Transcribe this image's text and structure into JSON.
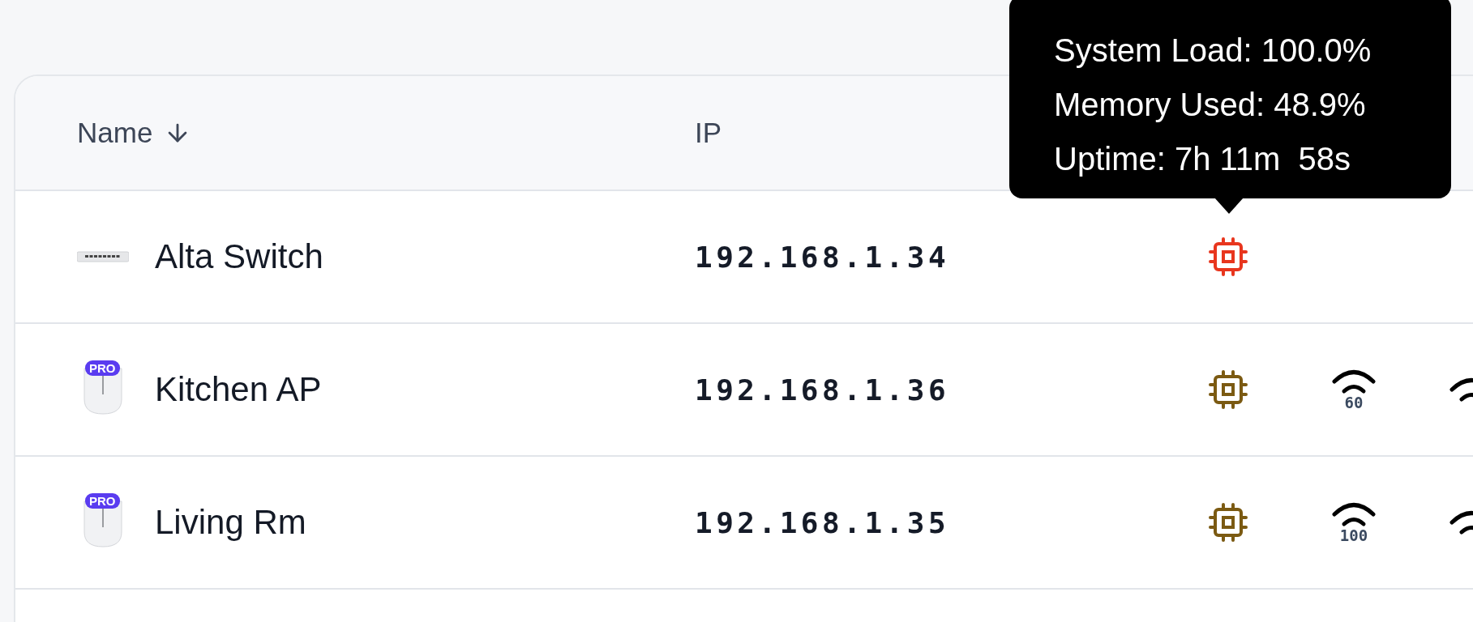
{
  "table": {
    "columns": [
      {
        "label": "Name",
        "sort_descending": true
      },
      {
        "label": "IP"
      }
    ],
    "rows": [
      {
        "kind": "switch",
        "name": "Alta Switch",
        "ip": "192.168.1.34",
        "color": "#e8361e",
        "radios": []
      },
      {
        "kind": "access_point",
        "badge": "PRO",
        "name": "Kitchen AP",
        "ip": "192.168.1.36",
        "color": "#7b5a12",
        "radios": [
          {
            "kind": "wifi",
            "reading": "60"
          },
          {
            "kind": "wifi"
          }
        ]
      },
      {
        "kind": "access_point",
        "badge": "PRO",
        "name": "Living Rm",
        "ip": "192.168.1.35",
        "color": "#7b5a12",
        "radios": [
          {
            "kind": "wifi",
            "reading": "100"
          },
          {
            "kind": "wifi"
          }
        ]
      }
    ]
  },
  "tooltip": {
    "lines": [
      "System Load: 100.0%",
      "Memory Used: 48.9%",
      "Uptime: 7h 11m  58s"
    ]
  }
}
